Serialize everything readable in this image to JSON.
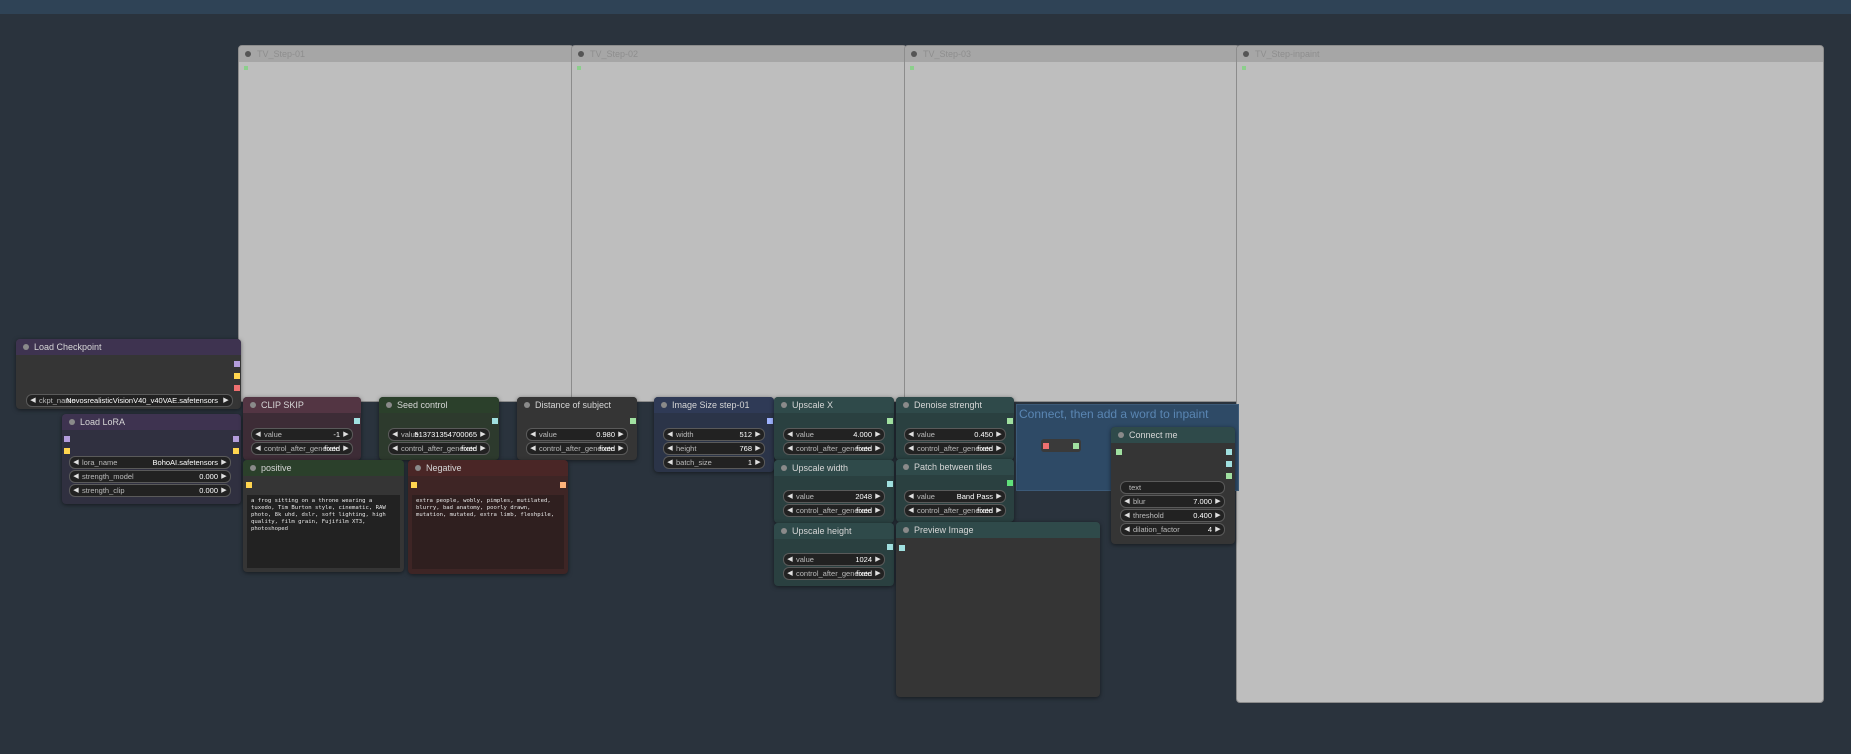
{
  "groups": [
    {
      "id": "g1",
      "title": "TV_Step-01"
    },
    {
      "id": "g2",
      "title": "TV_Step-02"
    },
    {
      "id": "g3",
      "title": "TV_Step-03"
    },
    {
      "id": "g4",
      "title": "TV_Step-inpaint"
    }
  ],
  "nodes": {
    "load_checkpoint": {
      "title": "Load Checkpoint",
      "ckpt_label": "ckpt_name",
      "ckpt_value": "NovosrealisticVisionV40_v40VAE.safetensors"
    },
    "load_lora": {
      "title": "Load LoRA",
      "lora_label": "lora_name",
      "lora_value": "BohoAI.safetensors",
      "sm_label": "strength_model",
      "sm_value": "0.000",
      "sc_label": "strength_clip",
      "sc_value": "0.000"
    },
    "clip_skip": {
      "title": "CLIP SKIP",
      "value_label": "value",
      "value": "-1",
      "caf_label": "control_after_generate",
      "caf_value": "fixed"
    },
    "seed_control": {
      "title": "Seed control",
      "value_label": "value",
      "value": "513731354700065",
      "caf_label": "control_after_generate",
      "caf_value": "fixed"
    },
    "distance": {
      "title": "Distance of subject",
      "value_label": "value",
      "value": "0.980",
      "caf_label": "control_after_generate",
      "caf_value": "fixed"
    },
    "image_size": {
      "title": "Image Size step-01",
      "w_label": "width",
      "w_value": "512",
      "h_label": "height",
      "h_value": "768",
      "b_label": "batch_size",
      "b_value": "1"
    },
    "upscale_x": {
      "title": "Upscale X",
      "value_label": "value",
      "value": "4.000",
      "caf_label": "control_after_generate",
      "caf_value": "fixed"
    },
    "denoise": {
      "title": "Denoise strenght",
      "value_label": "value",
      "value": "0.450",
      "caf_label": "control_after_generate",
      "caf_value": "fixed"
    },
    "upscale_w": {
      "title": "Upscale width",
      "value_label": "value",
      "value": "2048",
      "caf_label": "control_after_generate",
      "caf_value": "fixed"
    },
    "patch": {
      "title": "Patch between tiles",
      "value_label": "value",
      "value": "Band Pass",
      "caf_label": "control_after_generate",
      "caf_value": "fixed"
    },
    "upscale_h": {
      "title": "Upscale height",
      "value_label": "value",
      "value": "1024",
      "caf_label": "control_after_generate",
      "caf_value": "fixed"
    },
    "positive": {
      "title": "positive",
      "text": "a frog sitting on a throne wearing a tuxedo, Tim Burton style, cinematic, RAW photo, 8k uhd, dslr, soft lighting, high quality, film grain, Fujifilm XT3, photoshoped"
    },
    "negative": {
      "title": "Negative",
      "text": "extra people, wobly, pimples, mutilated, blurry, bad anatomy, poorly drawn, mutation, mutated, extra limb, fleshpile,"
    },
    "preview": {
      "title": "Preview Image"
    },
    "connect_me": {
      "title": "Connect me",
      "text_label": "text",
      "blur_label": "blur",
      "blur_value": "7.000",
      "thr_label": "threshold",
      "thr_value": "0.400",
      "dil_label": "dilation_factor",
      "dil_value": "4"
    },
    "inpaint_note": {
      "text": "Connect, then add a word to inpaint"
    }
  },
  "colors": {
    "canvas": "#2a333d",
    "group_fill": "#bebebe",
    "node_body": "#353535",
    "purple_title": "#3e3350",
    "pink_title": "#533543",
    "green_title": "#2b402b",
    "teal_title": "#2f4a4a",
    "teal_body": "#2a4040",
    "neg_title": "#4a2626",
    "neg_body": "#3e2525",
    "blue_title": "#2f3a56",
    "blue_body": "#2b3448"
  }
}
